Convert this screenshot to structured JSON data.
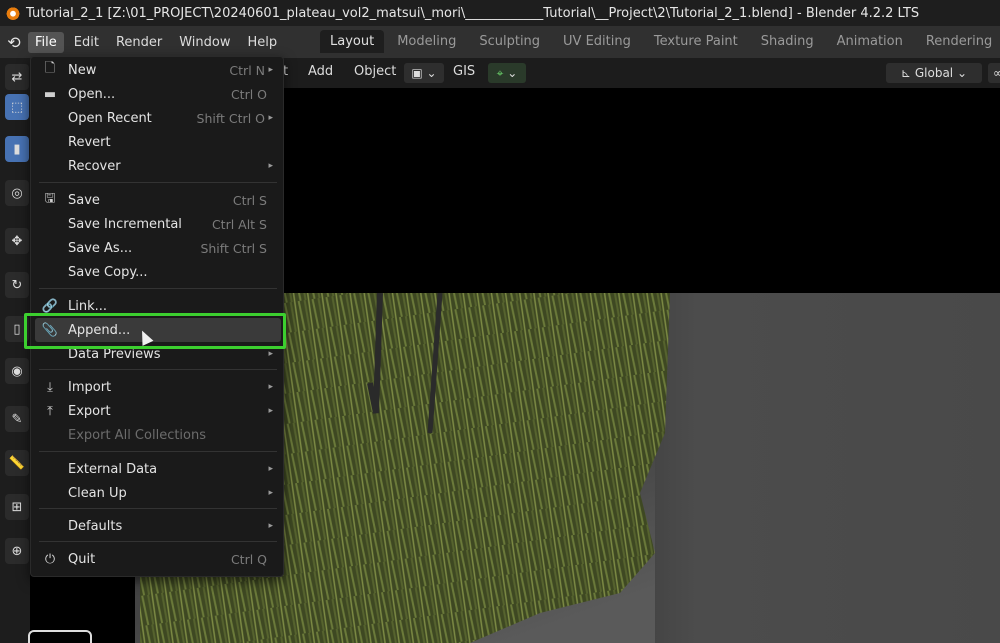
{
  "title_bar": {
    "title": "Tutorial_2_1 [Z:\\01_PROJECT\\20240601_plateau_vol2_matsui\\_mori\\____________Tutorial\\__Project\\2\\Tutorial_2_1.blend] - Blender 4.2.2 LTS"
  },
  "menubar": {
    "items": [
      "File",
      "Edit",
      "Render",
      "Window",
      "Help"
    ],
    "active": "File"
  },
  "workspaces": [
    "Layout",
    "Modeling",
    "Sculpting",
    "UV Editing",
    "Texture Paint",
    "Shading",
    "Animation",
    "Rendering"
  ],
  "viewport_header": {
    "partial_item": "t",
    "add": "Add",
    "object": "Object",
    "gis": "GIS",
    "transform_orientation": "Global"
  },
  "file_menu": {
    "items": [
      {
        "label": "New",
        "shortcut": "Ctrl N",
        "icon": "new-file-icon",
        "submenu": true
      },
      {
        "label": "Open...",
        "shortcut": "Ctrl O",
        "icon": "folder-icon"
      },
      {
        "label": "Open Recent",
        "shortcut": "Shift Ctrl O",
        "submenu": true
      },
      {
        "label": "Revert"
      },
      {
        "label": "Recover",
        "submenu": true
      },
      {
        "label": "Save",
        "shortcut": "Ctrl S",
        "icon": "save-icon"
      },
      {
        "label": "Save Incremental",
        "shortcut": "Ctrl Alt S"
      },
      {
        "label": "Save As...",
        "shortcut": "Shift Ctrl S"
      },
      {
        "label": "Save Copy..."
      },
      {
        "label": "Link...",
        "icon": "link-icon"
      },
      {
        "label": "Append...",
        "icon": "paperclip-icon",
        "highlighted": true
      },
      {
        "label": "Data Previews",
        "submenu": true
      },
      {
        "label": "Import",
        "icon": "import-icon",
        "submenu": true
      },
      {
        "label": "Export",
        "icon": "export-icon",
        "submenu": true
      },
      {
        "label": "Export All Collections",
        "disabled": true
      },
      {
        "label": "External Data",
        "submenu": true
      },
      {
        "label": "Clean Up",
        "submenu": true
      },
      {
        "label": "Defaults",
        "submenu": true
      },
      {
        "label": "Quit",
        "shortcut": "Ctrl Q",
        "icon": "power-icon"
      }
    ]
  },
  "colors": {
    "highlight_box": "#3ccf2f",
    "tree_foliage": "#4f5a2c",
    "selected_tool": "#4772b3"
  }
}
